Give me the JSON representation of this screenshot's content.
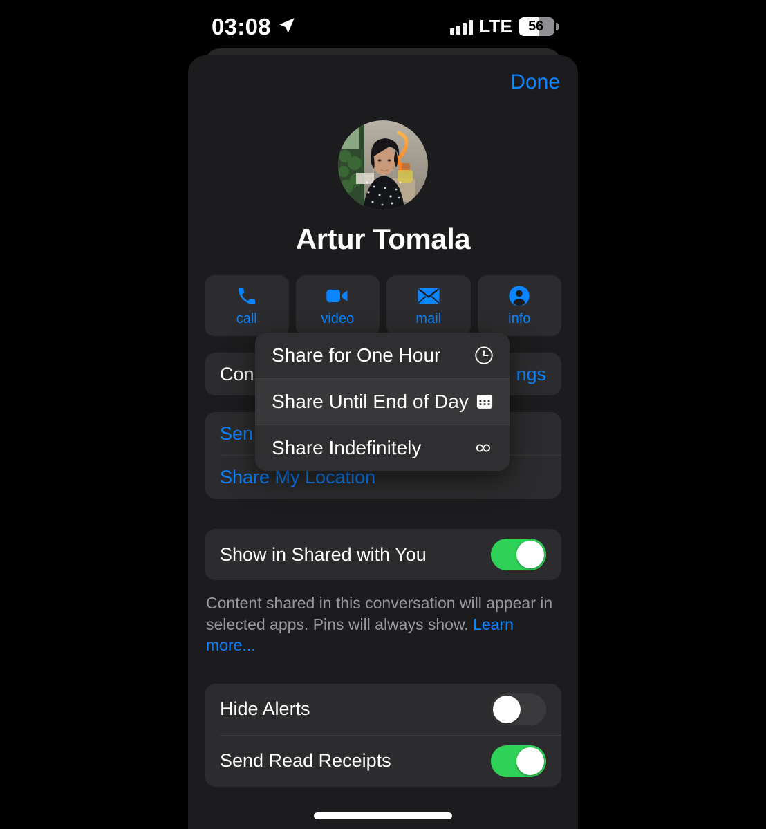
{
  "status_bar": {
    "time": "03:08",
    "location_icon": "location-arrow-icon",
    "network": "LTE",
    "battery_percent": "56",
    "battery_level": 56,
    "signal_bars": 4
  },
  "header": {
    "done_label": "Done"
  },
  "contact": {
    "name": "Artur Tomala",
    "avatar_alt": "contact-photo"
  },
  "actions": [
    {
      "label": "call",
      "icon": "phone-icon"
    },
    {
      "label": "video",
      "icon": "video-camera-icon"
    },
    {
      "label": "mail",
      "icon": "envelope-icon"
    },
    {
      "label": "info",
      "icon": "person-circle-icon"
    }
  ],
  "settings_group": {
    "row_label": "Con",
    "row_value": "ngs"
  },
  "location_group": {
    "send_label": "Sen",
    "share_label": "Share My Location"
  },
  "shared_with_you": {
    "label": "Show in Shared with You",
    "enabled": true,
    "footnote_text": "Content shared in this conversation will appear in selected apps. Pins will always show. ",
    "footnote_link": "Learn more..."
  },
  "alerts_group": {
    "hide_alerts_label": "Hide Alerts",
    "hide_alerts_enabled": false,
    "read_receipts_label": "Send Read Receipts",
    "read_receipts_enabled": true
  },
  "context_menu": {
    "items": [
      {
        "label": "Share for One Hour",
        "icon": "clock-icon",
        "highlighted": false
      },
      {
        "label": "Share Until End of Day",
        "icon": "calendar-icon",
        "highlighted": true
      },
      {
        "label": "Share Indefinitely",
        "icon": "infinity-icon",
        "highlighted": false
      }
    ]
  },
  "colors": {
    "accent_blue": "#0a84ff",
    "toggle_on_green": "#30d158",
    "sheet_bg": "#1c1c1e",
    "card_bg": "#2c2c2e",
    "menu_bg": "#2f2f31"
  }
}
